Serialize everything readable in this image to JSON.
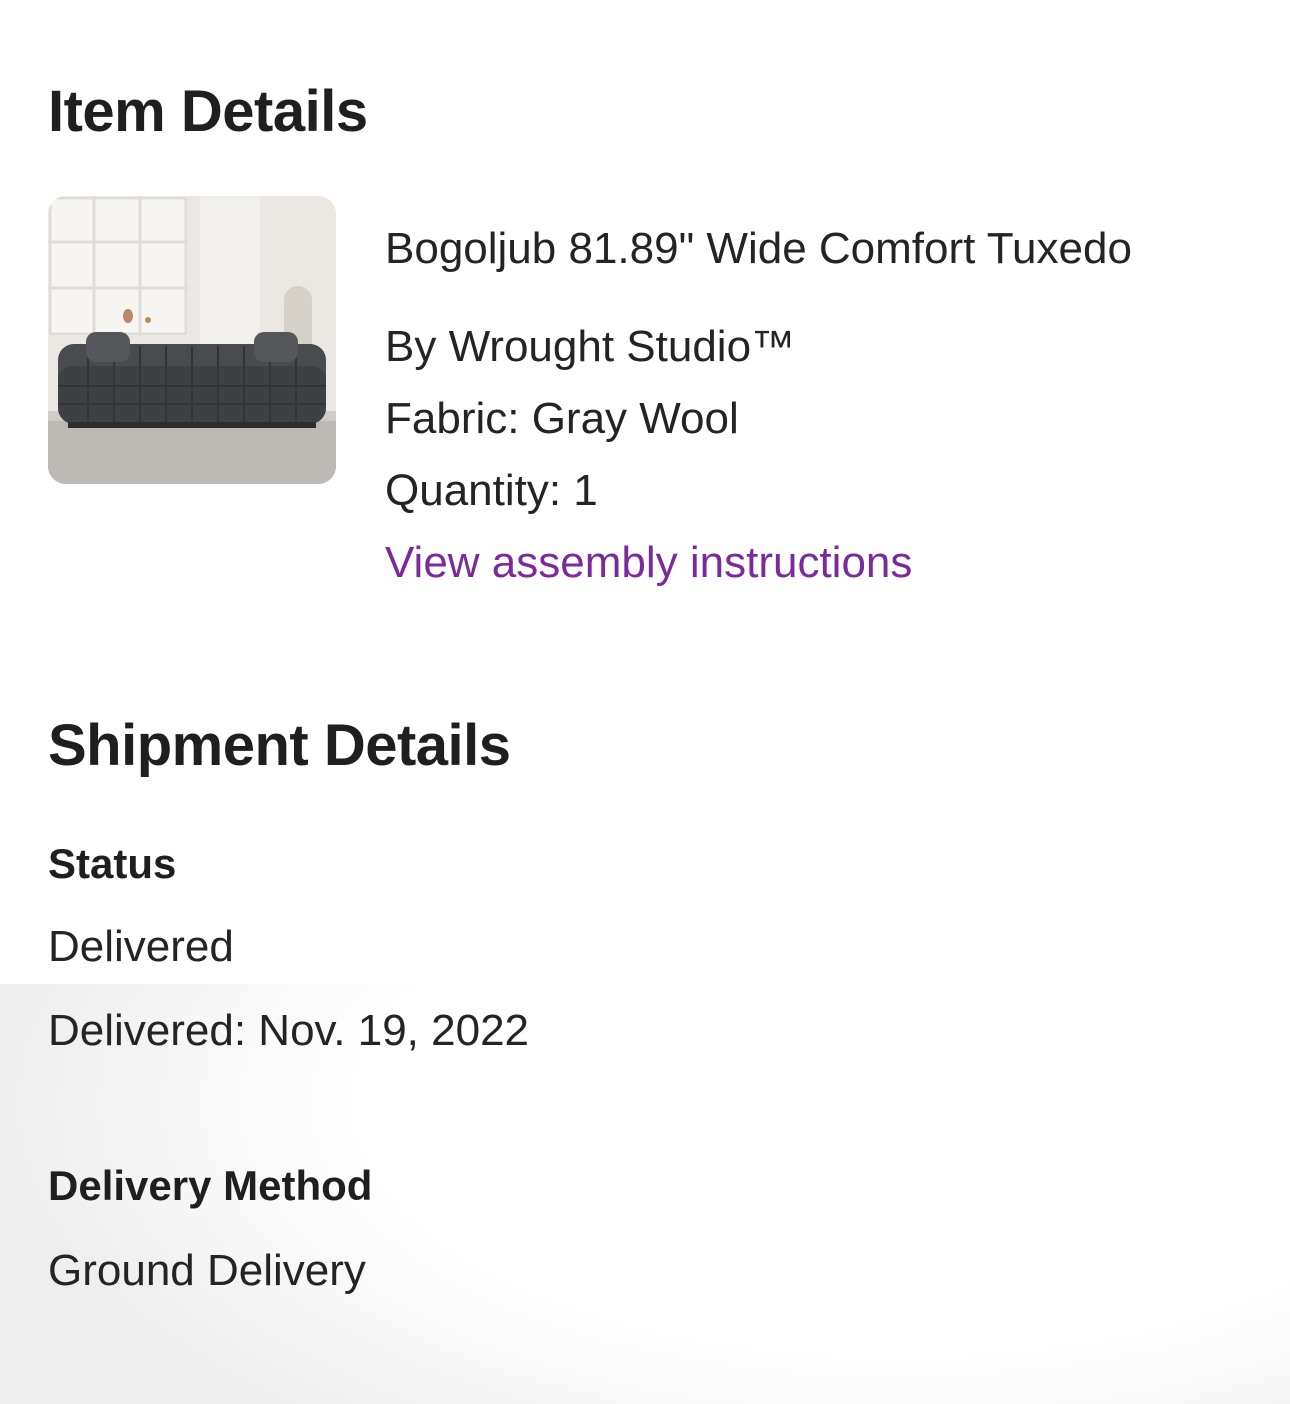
{
  "item_details": {
    "title": "Item Details",
    "product": {
      "image_icon": "sofa-product-image",
      "name": "Bogoljub 81.89\" Wide Comfort Tuxedo",
      "brand": "By Wrought Studio™",
      "fabric": "Fabric: Gray Wool",
      "quantity": "Quantity: 1",
      "assembly_link": "View assembly instructions"
    }
  },
  "shipment_details": {
    "title": "Shipment Details",
    "status": {
      "label": "Status",
      "value": "Delivered",
      "delivered_date": "Delivered: Nov. 19, 2022"
    },
    "delivery_method": {
      "label": "Delivery Method",
      "value": "Ground Delivery"
    }
  },
  "colors": {
    "link": "#7b2a9b",
    "text": "#242424",
    "background": "#ffffff"
  }
}
